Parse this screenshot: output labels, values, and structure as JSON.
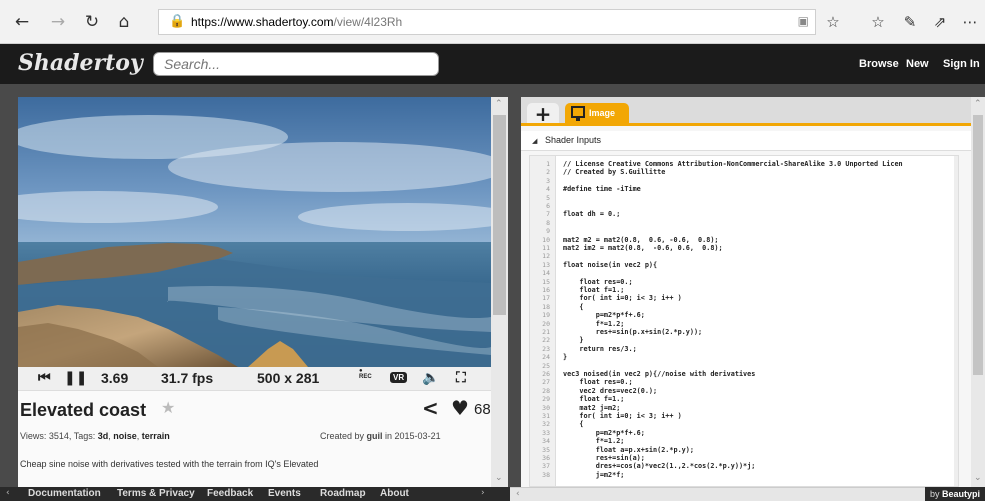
{
  "browser": {
    "url_host": "https://www.shadertoy.com",
    "url_path": "/view/4l23Rh"
  },
  "site": {
    "logo": "Shadertoy",
    "search_placeholder": "Search...",
    "nav": [
      "Browse",
      "New",
      "Sign In"
    ]
  },
  "player": {
    "time": "3.69",
    "fps": "31.7 fps",
    "resolution": "500 x 281",
    "rec_label": "REC",
    "vr_label": "VR"
  },
  "shader": {
    "title": "Elevated coast",
    "likes": "68",
    "views_label": "Views: 3514, Tags: ",
    "tags": [
      "3d",
      "noise",
      "terrain"
    ],
    "created_prefix": "Created by ",
    "author": "guil",
    "created_suffix": " in 2015-03-21",
    "description": "Cheap sine noise with derivatives tested with the terrain from IQ's Elevated"
  },
  "footer": {
    "links": [
      "Documentation",
      "Terms & Privacy",
      "Feedback",
      "Events",
      "Roadmap",
      "About"
    ],
    "by_prefix": "by ",
    "by_name": "Beautypi"
  },
  "editor": {
    "tab_image": "Image",
    "shader_inputs": "Shader Inputs",
    "line_numbers": [
      "1",
      "2",
      "3",
      "4",
      "5",
      "6",
      "7",
      "8",
      "9",
      "10",
      "11",
      "12",
      "13",
      "14",
      "15",
      "16",
      "17",
      "18",
      "19",
      "20",
      "21",
      "22",
      "23",
      "24",
      "25",
      "26",
      "27",
      "28",
      "29",
      "30",
      "31",
      "32",
      "33",
      "34",
      "35",
      "36",
      "37",
      "38"
    ],
    "code": [
      "// License Creative Commons Attribution-NonCommercial-ShareAlike 3.0 Unported Licen",
      "// Created by S.Guillitte",
      "",
      "#define time -iTime",
      "",
      "",
      "float dh = 0.;",
      "",
      "",
      "mat2 m2 = mat2(0.8,  0.6, -0.6,  0.8);",
      "mat2 im2 = mat2(0.8,  -0.6, 0.6,  0.8);",
      "",
      "float noise(in vec2 p){",
      "",
      "    float res=0.;",
      "    float f=1.;",
      "    for( int i=0; i< 3; i++ )",
      "    {",
      "        p=m2*p*f+.6;",
      "        f*=1.2;",
      "        res+=sin(p.x+sin(2.*p.y));",
      "    }",
      "    return res/3.;",
      "}",
      "",
      "vec3 noised(in vec2 p){//noise with derivatives",
      "    float res=0.;",
      "    vec2 dres=vec2(0.);",
      "    float f=1.;",
      "    mat2 j=m2;",
      "    for( int i=0; i< 3; i++ )",
      "    {",
      "        p=m2*p*f+.6;",
      "        f*=1.2;",
      "        float a=p.x+sin(2.*p.y);",
      "        res+=sin(a);",
      "        dres+=cos(a)*vec2(1.,2.*cos(2.*p.y))*j;",
      "        j=m2*f;"
    ]
  }
}
